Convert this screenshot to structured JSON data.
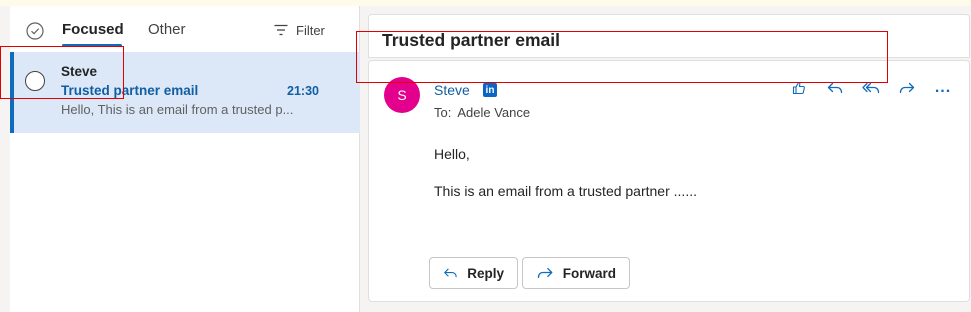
{
  "list": {
    "tabs": {
      "focused": "Focused",
      "other": "Other"
    },
    "filter_label": "Filter",
    "selected_item": {
      "sender": "Steve",
      "subject": "Trusted partner email",
      "time": "21:30",
      "preview": "Hello, This is an email from a trusted p..."
    }
  },
  "reading": {
    "subject": "Trusted partner email",
    "avatar_initial": "S",
    "from": "Steve",
    "linkedin_badge": "in",
    "to_label": "To:",
    "to_name": "Adele Vance",
    "body": [
      "Hello,",
      "This is an email from a trusted partner ......"
    ],
    "more_label": "...",
    "reply_label": "Reply",
    "forward_label": "Forward"
  },
  "colors": {
    "accent": "#0f6cbd",
    "selected_row": "#dce8f7",
    "avatar": "#e3008c",
    "annotation": "#e00000"
  },
  "icons": [
    "select-all-icon",
    "filter-icon",
    "like-icon",
    "reply-icon",
    "reply-all-icon",
    "forward-icon",
    "more-icon",
    "linkedin-icon"
  ]
}
